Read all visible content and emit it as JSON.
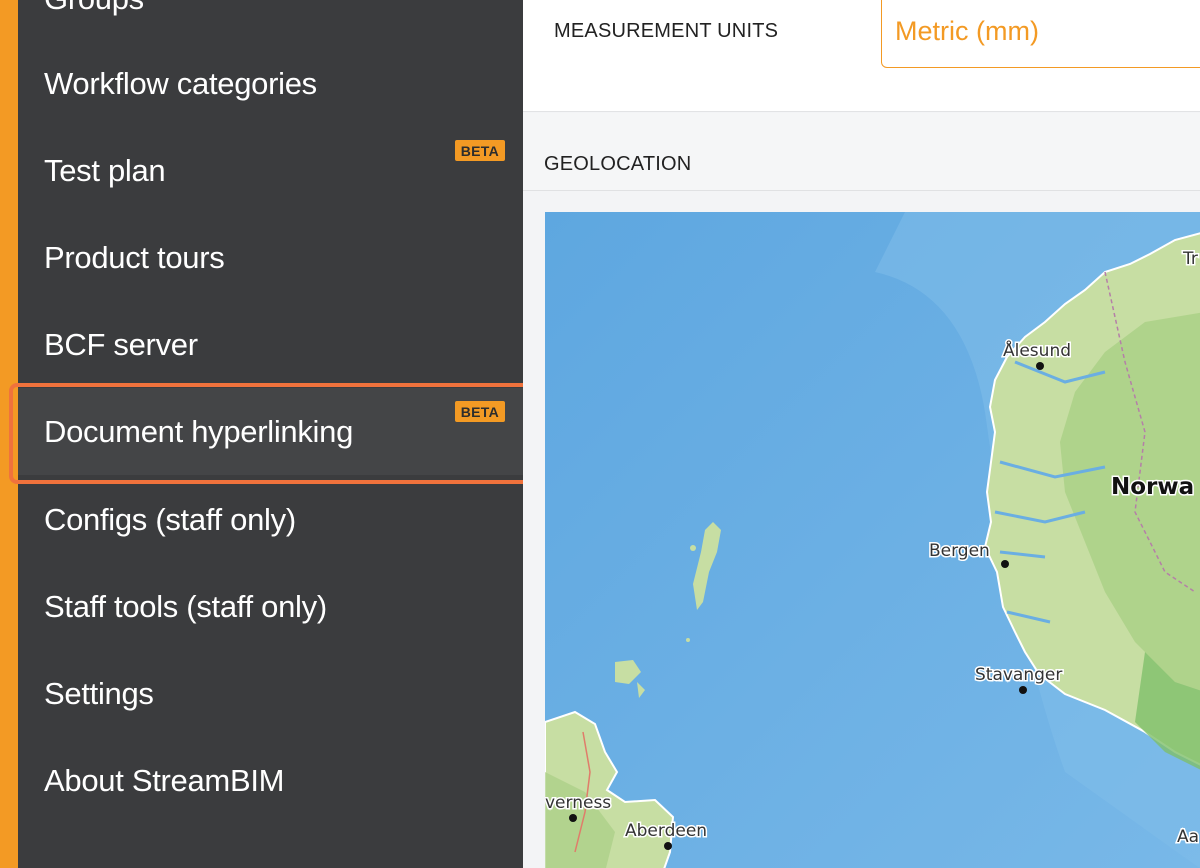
{
  "sidebar": {
    "items": [
      {
        "label": "Groups",
        "badge": null
      },
      {
        "label": "Workflow categories",
        "badge": null
      },
      {
        "label": "Test plan",
        "badge": "BETA"
      },
      {
        "label": "Product tours",
        "badge": null
      },
      {
        "label": "BCF server",
        "badge": null
      },
      {
        "label": "Document hyperlinking",
        "badge": "BETA"
      },
      {
        "label": "Configs (staff only)",
        "badge": null
      },
      {
        "label": "Staff tools (staff only)",
        "badge": null
      },
      {
        "label": "Settings",
        "badge": null
      },
      {
        "label": "About StreamBIM",
        "badge": null
      }
    ]
  },
  "settings": {
    "measurement_units_label": "MEASUREMENT UNITS",
    "measurement_units_value": "Metric (mm)",
    "geolocation_label": "GEOLOCATION"
  },
  "map": {
    "country": "Norwa",
    "cities": {
      "alesund": "Ålesund",
      "bergen": "Bergen",
      "stavanger": "Stavanger",
      "inverness": "verness",
      "aberdeen": "Aberdeen"
    },
    "edge_labels": {
      "top_right": "Tr",
      "bottom_right": "Aa"
    }
  },
  "colors": {
    "accent": "#f39a24",
    "sidebar_bg": "#3b3c3e",
    "highlight": "#f0723c",
    "sea": "#6aaee2",
    "land": "#c5dd9f"
  }
}
